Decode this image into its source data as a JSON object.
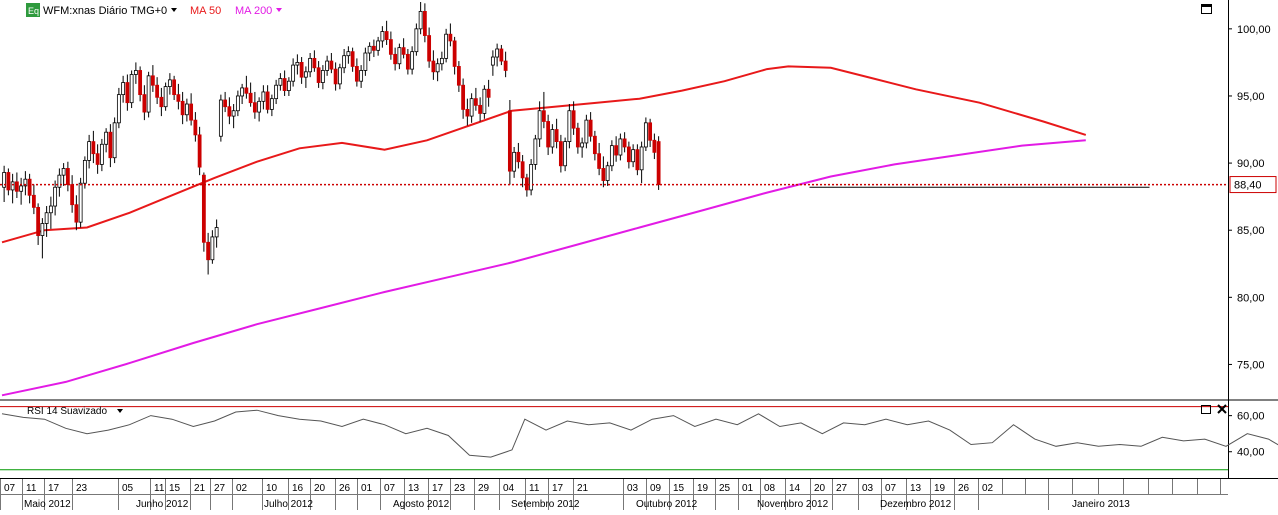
{
  "header": {
    "symbol_badge": "Eq",
    "symbol": "WFM:xnas Diário TMG+0",
    "ma50_label": "MA 50",
    "ma200_label": "MA 200",
    "rsi_label": "RSI 14 Suavizado"
  },
  "colors": {
    "background": "#ffffff",
    "grid": "#d8d8d8",
    "candle_up": "#ffffff",
    "candle_down": "#cc0000",
    "candle_outline": "#000000",
    "ma50": "#e8191a",
    "ma200": "#e21be5",
    "last_price_line": "#cc0000",
    "support_line": "#000000",
    "rsi_line": "#555555",
    "rsi_upper": "#cc0000",
    "rsi_lower": "#009900",
    "badge": "#2e9a3d"
  },
  "price_axis": {
    "ticks": [
      "100,00",
      "95,00",
      "90,00",
      "85,00",
      "80,00",
      "75,00"
    ],
    "last_price": "88,40"
  },
  "rsi_axis": {
    "ticks": [
      "60,00",
      "40,00"
    ]
  },
  "date_axis": {
    "days": [
      "07",
      "11",
      "17",
      "23",
      "05",
      "11",
      "15",
      "21",
      "27",
      "02",
      "10",
      "16",
      "20",
      "26",
      "01",
      "07",
      "13",
      "17",
      "23",
      "29",
      "04",
      "11",
      "17",
      "21",
      "03",
      "09",
      "15",
      "19",
      "25",
      "01",
      "08",
      "14",
      "20",
      "27",
      "03",
      "07",
      "13",
      "19",
      "26",
      "02"
    ],
    "months": [
      "Maio 2012",
      "Junho 2012",
      "Julho 2012",
      "Agosto 2012",
      "Setembro 2012",
      "Outubro 2012",
      "Novembro 2012",
      "Dezembro 2012",
      "Janeiro 2013"
    ]
  },
  "chart_data": {
    "type": "candlestick",
    "symbol": "WFM",
    "ylim": [
      72.5,
      102
    ],
    "rsi_ylim": [
      26,
      67
    ],
    "rsi_levels": [
      65,
      30
    ],
    "candles": [
      [
        88.2,
        89.8,
        87.1,
        89.3
      ],
      [
        89.3,
        89.6,
        87.6,
        88.0
      ],
      [
        88.0,
        89.2,
        87.0,
        88.6
      ],
      [
        88.6,
        89.3,
        87.4,
        87.9
      ],
      [
        87.9,
        88.9,
        86.9,
        88.3
      ],
      [
        88.3,
        89.4,
        87.6,
        88.8
      ],
      [
        88.8,
        89.2,
        87.0,
        87.6
      ],
      [
        87.6,
        88.4,
        86.2,
        86.7
      ],
      [
        86.7,
        87.0,
        83.9,
        84.6
      ],
      [
        84.6,
        85.9,
        82.9,
        85.5
      ],
      [
        85.5,
        86.8,
        84.5,
        86.3
      ],
      [
        86.3,
        87.5,
        85.1,
        86.8
      ],
      [
        86.8,
        88.7,
        86.1,
        88.2
      ],
      [
        88.2,
        89.6,
        87.5,
        89.1
      ],
      [
        89.1,
        90.0,
        88.3,
        89.6
      ],
      [
        89.6,
        90.1,
        87.9,
        88.4
      ],
      [
        88.4,
        89.1,
        86.3,
        86.9
      ],
      [
        86.9,
        87.6,
        85.0,
        85.6
      ],
      [
        85.6,
        88.9,
        85.2,
        88.5
      ],
      [
        88.5,
        90.5,
        88.1,
        90.2
      ],
      [
        90.2,
        92.1,
        89.6,
        91.6
      ],
      [
        91.6,
        92.4,
        90.0,
        90.7
      ],
      [
        90.7,
        91.4,
        89.2,
        89.9
      ],
      [
        89.9,
        91.8,
        89.4,
        91.4
      ],
      [
        91.4,
        92.6,
        90.8,
        92.3
      ],
      [
        92.3,
        92.9,
        89.7,
        90.4
      ],
      [
        90.4,
        93.4,
        90.0,
        93.0
      ],
      [
        93.0,
        95.6,
        92.6,
        95.1
      ],
      [
        95.1,
        96.5,
        94.5,
        96.0
      ],
      [
        96.0,
        96.6,
        93.9,
        94.5
      ],
      [
        94.5,
        96.9,
        94.1,
        96.6
      ],
      [
        96.6,
        97.5,
        95.9,
        96.9
      ],
      [
        96.9,
        97.2,
        94.6,
        95.1
      ],
      [
        95.1,
        95.8,
        93.2,
        93.8
      ],
      [
        93.8,
        96.8,
        93.4,
        96.5
      ],
      [
        96.5,
        97.3,
        95.3,
        95.8
      ],
      [
        95.8,
        96.4,
        94.4,
        94.9
      ],
      [
        94.9,
        95.6,
        93.5,
        94.2
      ],
      [
        94.2,
        96.0,
        93.9,
        95.7
      ],
      [
        95.7,
        96.7,
        95.1,
        96.2
      ],
      [
        96.2,
        96.5,
        94.7,
        95.1
      ],
      [
        95.1,
        95.9,
        94.0,
        94.6
      ],
      [
        94.6,
        95.3,
        92.9,
        93.6
      ],
      [
        93.6,
        94.8,
        93.1,
        94.4
      ],
      [
        94.4,
        95.2,
        92.8,
        93.2
      ],
      [
        93.2,
        93.8,
        91.6,
        92.1
      ],
      [
        92.1,
        92.7,
        89.1,
        89.7
      ],
      [
        89.1,
        89.3,
        83.4,
        84.1
      ],
      [
        84.1,
        84.8,
        81.7,
        82.8
      ],
      [
        82.8,
        85.0,
        82.5,
        84.5
      ],
      [
        84.5,
        85.8,
        83.7,
        85.2
      ],
      [
        92.0,
        95.1,
        91.6,
        94.7
      ],
      [
        94.7,
        95.3,
        93.8,
        94.2
      ],
      [
        94.2,
        94.9,
        92.9,
        93.5
      ],
      [
        93.5,
        94.4,
        92.6,
        93.9
      ],
      [
        93.9,
        95.4,
        93.5,
        95.0
      ],
      [
        95.0,
        95.9,
        94.4,
        95.6
      ],
      [
        95.6,
        96.5,
        94.8,
        95.2
      ],
      [
        95.2,
        96.0,
        94.2,
        94.5
      ],
      [
        94.5,
        95.3,
        93.3,
        93.8
      ],
      [
        93.8,
        94.9,
        93.1,
        94.6
      ],
      [
        94.6,
        95.8,
        94.0,
        95.3
      ],
      [
        95.3,
        95.8,
        93.7,
        94.0
      ],
      [
        94.0,
        95.1,
        93.5,
        94.8
      ],
      [
        94.8,
        96.2,
        94.4,
        95.8
      ],
      [
        95.8,
        96.7,
        95.4,
        96.3
      ],
      [
        96.3,
        96.9,
        95.0,
        95.4
      ],
      [
        95.4,
        96.4,
        95.0,
        96.1
      ],
      [
        96.1,
        97.8,
        95.7,
        97.3
      ],
      [
        97.3,
        98.1,
        96.6,
        97.5
      ],
      [
        97.5,
        97.9,
        95.9,
        96.4
      ],
      [
        96.4,
        97.2,
        95.6,
        96.8
      ],
      [
        96.8,
        98.2,
        96.4,
        97.8
      ],
      [
        97.8,
        98.4,
        96.8,
        97.1
      ],
      [
        97.1,
        97.6,
        95.6,
        96.0
      ],
      [
        96.0,
        97.3,
        95.5,
        96.9
      ],
      [
        96.9,
        98.0,
        96.5,
        97.6
      ],
      [
        97.6,
        98.2,
        96.7,
        97.0
      ],
      [
        97.0,
        97.5,
        95.4,
        95.9
      ],
      [
        95.9,
        97.4,
        95.5,
        97.1
      ],
      [
        97.1,
        98.5,
        96.7,
        98.0
      ],
      [
        98.0,
        98.7,
        97.4,
        98.3
      ],
      [
        98.3,
        98.6,
        96.8,
        97.2
      ],
      [
        97.2,
        97.8,
        95.7,
        96.1
      ],
      [
        96.1,
        97.3,
        95.6,
        96.9
      ],
      [
        96.9,
        98.6,
        96.5,
        98.2
      ],
      [
        98.2,
        99.0,
        97.6,
        98.7
      ],
      [
        98.7,
        99.2,
        97.9,
        98.4
      ],
      [
        98.4,
        99.4,
        98.0,
        99.1
      ],
      [
        99.1,
        100.2,
        98.6,
        99.8
      ],
      [
        99.8,
        100.6,
        98.8,
        99.2
      ],
      [
        99.2,
        99.8,
        97.7,
        98.1
      ],
      [
        98.1,
        98.6,
        96.9,
        97.4
      ],
      [
        97.4,
        98.9,
        97.0,
        98.6
      ],
      [
        98.6,
        99.3,
        97.8,
        98.1
      ],
      [
        98.1,
        98.5,
        96.6,
        97.0
      ],
      [
        97.0,
        98.7,
        96.6,
        98.3
      ],
      [
        98.3,
        100.4,
        98.0,
        100.0
      ],
      [
        100.0,
        102.0,
        99.6,
        101.3
      ],
      [
        101.3,
        101.9,
        99.0,
        99.5
      ],
      [
        99.5,
        100.1,
        97.1,
        97.6
      ],
      [
        97.6,
        98.4,
        96.2,
        96.8
      ],
      [
        96.8,
        97.8,
        96.1,
        97.4
      ],
      [
        97.4,
        98.3,
        96.9,
        97.8
      ],
      [
        97.8,
        100.0,
        97.5,
        99.6
      ],
      [
        99.6,
        100.4,
        98.7,
        99.1
      ],
      [
        99.1,
        99.4,
        96.6,
        97.2
      ],
      [
        97.2,
        97.6,
        95.3,
        95.8
      ],
      [
        95.8,
        96.3,
        93.3,
        94.0
      ],
      [
        94.0,
        94.8,
        92.8,
        93.5
      ],
      [
        93.5,
        95.2,
        93.0,
        94.8
      ],
      [
        94.8,
        95.6,
        93.9,
        94.3
      ],
      [
        94.3,
        94.9,
        93.1,
        93.7
      ],
      [
        93.7,
        95.8,
        93.3,
        95.5
      ],
      [
        95.5,
        96.2,
        94.2,
        94.9
      ],
      [
        97.3,
        98.4,
        96.5,
        97.9
      ],
      [
        97.9,
        98.9,
        97.2,
        98.5
      ],
      [
        98.5,
        98.8,
        97.3,
        97.6
      ],
      [
        97.6,
        98.3,
        96.4,
        96.9
      ],
      [
        93.9,
        94.7,
        88.4,
        89.4
      ],
      [
        89.4,
        91.2,
        88.9,
        90.8
      ],
      [
        90.8,
        91.5,
        89.6,
        90.1
      ],
      [
        90.1,
        90.6,
        88.2,
        88.9
      ],
      [
        88.9,
        89.2,
        87.5,
        88.0
      ],
      [
        88.0,
        90.3,
        87.6,
        89.9
      ],
      [
        89.9,
        92.1,
        89.5,
        91.8
      ],
      [
        91.8,
        94.6,
        91.2,
        93.9
      ],
      [
        93.9,
        95.3,
        92.6,
        93.1
      ],
      [
        93.1,
        93.6,
        90.6,
        91.2
      ],
      [
        91.2,
        92.9,
        90.7,
        92.5
      ],
      [
        92.5,
        93.3,
        91.1,
        91.6
      ],
      [
        91.6,
        92.1,
        89.3,
        89.8
      ],
      [
        89.8,
        91.9,
        89.4,
        91.6
      ],
      [
        91.6,
        94.4,
        91.1,
        93.9
      ],
      [
        93.9,
        94.6,
        92.1,
        92.6
      ],
      [
        92.6,
        93.0,
        90.7,
        91.2
      ],
      [
        91.2,
        91.9,
        90.4,
        91.5
      ],
      [
        91.5,
        93.6,
        91.1,
        93.2
      ],
      [
        93.2,
        93.8,
        91.6,
        92.0
      ],
      [
        92.0,
        92.4,
        90.2,
        90.7
      ],
      [
        90.7,
        91.5,
        89.1,
        89.6
      ],
      [
        89.6,
        90.5,
        88.2,
        88.7
      ],
      [
        88.7,
        90.1,
        88.3,
        89.8
      ],
      [
        89.8,
        91.7,
        89.4,
        91.3
      ],
      [
        91.3,
        92.0,
        90.1,
        90.6
      ],
      [
        90.6,
        92.2,
        90.2,
        91.8
      ],
      [
        91.8,
        92.3,
        90.8,
        91.2
      ],
      [
        91.2,
        91.6,
        89.6,
        90.1
      ],
      [
        90.1,
        91.4,
        89.7,
        91.0
      ],
      [
        91.0,
        91.4,
        89.1,
        89.5
      ],
      [
        89.5,
        91.6,
        88.5,
        91.2
      ],
      [
        91.2,
        93.4,
        90.9,
        93.0
      ],
      [
        93.0,
        93.3,
        91.2,
        91.7
      ],
      [
        91.7,
        92.2,
        90.3,
        90.8
      ],
      [
        91.6,
        92.0,
        88.0,
        88.4
      ]
    ],
    "ma50": [
      [
        0,
        84.1
      ],
      [
        10,
        85.0
      ],
      [
        20,
        85.2
      ],
      [
        30,
        86.3
      ],
      [
        40,
        87.6
      ],
      [
        50,
        88.9
      ],
      [
        60,
        90.1
      ],
      [
        70,
        91.1
      ],
      [
        80,
        91.5
      ],
      [
        90,
        91.0
      ],
      [
        100,
        91.7
      ],
      [
        110,
        92.8
      ],
      [
        120,
        93.9
      ],
      [
        130,
        94.2
      ],
      [
        140,
        94.5
      ],
      [
        150,
        94.8
      ],
      [
        160,
        95.4
      ],
      [
        170,
        96.1
      ],
      [
        180,
        97.0
      ],
      [
        185,
        97.2
      ],
      [
        195,
        97.1
      ],
      [
        205,
        96.3
      ],
      [
        215,
        95.5
      ],
      [
        230,
        94.5
      ],
      [
        245,
        93.1
      ],
      [
        255,
        92.1
      ]
    ],
    "ma200": [
      [
        0,
        72.7
      ],
      [
        15,
        73.7
      ],
      [
        30,
        75.1
      ],
      [
        45,
        76.6
      ],
      [
        60,
        78.0
      ],
      [
        75,
        79.2
      ],
      [
        90,
        80.4
      ],
      [
        105,
        81.5
      ],
      [
        120,
        82.6
      ],
      [
        135,
        83.9
      ],
      [
        150,
        85.2
      ],
      [
        165,
        86.5
      ],
      [
        180,
        87.8
      ],
      [
        195,
        89.0
      ],
      [
        210,
        89.9
      ],
      [
        225,
        90.6
      ],
      [
        240,
        91.3
      ],
      [
        255,
        91.7
      ]
    ],
    "last_price": 88.4,
    "support": {
      "from": 190,
      "to": 270,
      "value": 88.2
    },
    "rsi": [
      [
        0,
        61
      ],
      [
        5,
        59
      ],
      [
        10,
        58
      ],
      [
        15,
        53
      ],
      [
        20,
        50
      ],
      [
        25,
        52
      ],
      [
        30,
        55
      ],
      [
        35,
        60
      ],
      [
        40,
        58
      ],
      [
        45,
        54
      ],
      [
        50,
        57
      ],
      [
        55,
        62
      ],
      [
        60,
        63
      ],
      [
        65,
        60
      ],
      [
        70,
        58
      ],
      [
        75,
        57
      ],
      [
        80,
        54
      ],
      [
        85,
        58
      ],
      [
        90,
        55
      ],
      [
        95,
        50
      ],
      [
        100,
        53
      ],
      [
        105,
        49
      ],
      [
        110,
        38
      ],
      [
        115,
        37
      ],
      [
        120,
        41
      ],
      [
        123,
        58
      ],
      [
        128,
        52
      ],
      [
        133,
        57
      ],
      [
        138,
        55
      ],
      [
        143,
        56
      ],
      [
        148,
        52
      ],
      [
        153,
        58
      ],
      [
        158,
        60
      ],
      [
        163,
        54
      ],
      [
        168,
        58
      ],
      [
        173,
        55
      ],
      [
        178,
        61
      ],
      [
        183,
        54
      ],
      [
        188,
        56
      ],
      [
        193,
        50
      ],
      [
        198,
        56
      ],
      [
        203,
        55
      ],
      [
        208,
        58
      ],
      [
        213,
        55
      ],
      [
        218,
        57
      ],
      [
        223,
        52
      ],
      [
        228,
        44
      ],
      [
        233,
        45
      ],
      [
        238,
        55
      ],
      [
        243,
        47
      ],
      [
        248,
        43
      ],
      [
        253,
        45
      ],
      [
        258,
        43
      ],
      [
        263,
        44
      ],
      [
        268,
        43
      ],
      [
        273,
        48
      ],
      [
        278,
        46
      ],
      [
        283,
        47
      ],
      [
        288,
        43
      ],
      [
        293,
        50
      ],
      [
        298,
        47
      ],
      [
        303,
        40
      ]
    ]
  }
}
